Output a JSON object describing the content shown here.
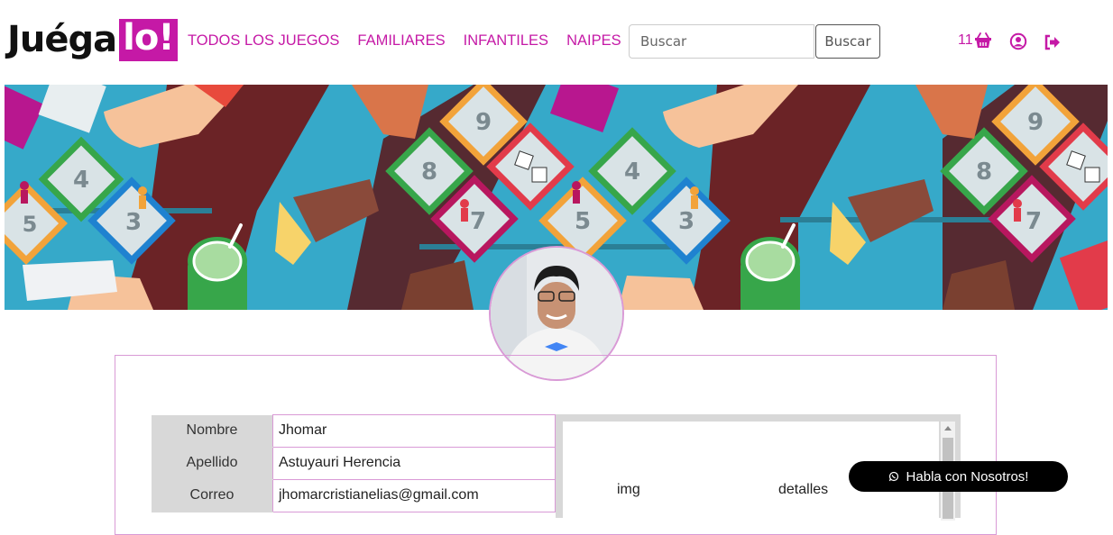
{
  "brand": {
    "logo_main": "Juéga",
    "logo_box": "lo!",
    "accent_color": "#c519a6"
  },
  "nav": {
    "links": [
      {
        "label": "TODOS LOS JUEGOS"
      },
      {
        "label": "FAMILIARES"
      },
      {
        "label": "INFANTILES"
      },
      {
        "label": "NAIPES"
      }
    ]
  },
  "search": {
    "placeholder": "Buscar",
    "button_label": "Buscar"
  },
  "header_actions": {
    "cart_count": "11",
    "icons": [
      "basket-icon",
      "user-circle-icon",
      "sign-out-icon"
    ]
  },
  "profile": {
    "fields": [
      {
        "label": "Nombre",
        "value": "Jhomar"
      },
      {
        "label": "Apellido",
        "value": "Astuyauri Herencia"
      },
      {
        "label": "Correo",
        "value": "jhomarcristianelias@gmail.com"
      }
    ],
    "orders_columns": [
      "img",
      "detalles"
    ]
  },
  "chat": {
    "label": "Habla con Nosotros!",
    "icon": "whatsapp-icon"
  }
}
